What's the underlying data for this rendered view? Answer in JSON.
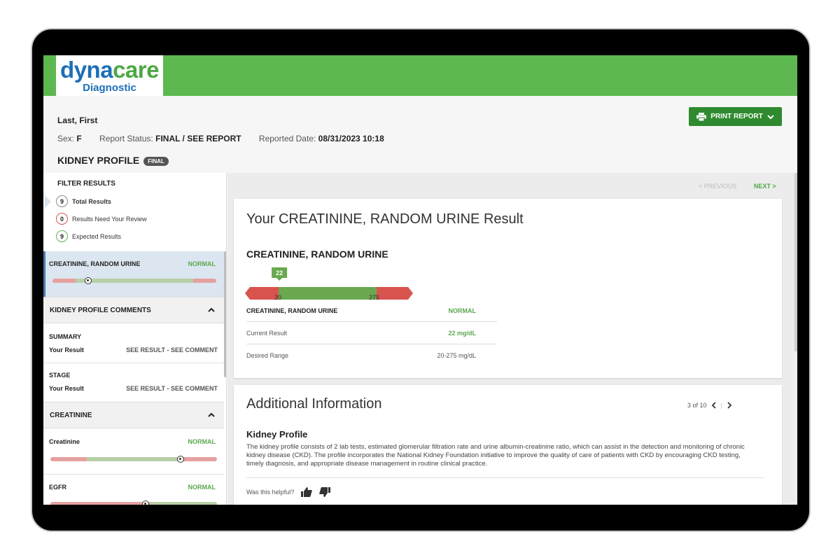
{
  "brand": {
    "name_part1": "dyna",
    "name_part2": "care",
    "subtitle": "Diagnostic",
    "green": "#5cb84f",
    "blue": "#1d6fb8"
  },
  "patient": {
    "name": "Last, First",
    "sex_label": "Sex:",
    "sex": "F",
    "status_label": "Report Status:",
    "status": "FINAL / SEE REPORT",
    "date_label": "Reported Date:",
    "date": "08/31/2023 10:18",
    "profile": "KIDNEY PROFILE",
    "profile_badge": "FINAL"
  },
  "toolbar": {
    "print_label": "PRINT REPORT",
    "print_icon": "printer-icon"
  },
  "filters": {
    "title": "FILTER RESULTS",
    "items": [
      {
        "count": "9",
        "label": "Total Results"
      },
      {
        "count": "0",
        "label": "Results Need Your Review"
      },
      {
        "count": "9",
        "label": "Expected Results"
      }
    ]
  },
  "sidebar": {
    "selected": {
      "name": "CREATININE, RANDOM URINE",
      "status": "NORMAL",
      "marker_fraction": 0.22
    },
    "comments": {
      "title": "KIDNEY PROFILE COMMENTS",
      "summary": {
        "title": "SUMMARY",
        "label": "Your Result",
        "value": "SEE RESULT - SEE COMMENT"
      },
      "stage": {
        "title": "STAGE",
        "label": "Your Result",
        "value": "SEE RESULT - SEE COMMENT"
      }
    },
    "creatinine_section": {
      "title": "CREATININE"
    },
    "creatinine": {
      "name": "Creatinine",
      "status": "NORMAL",
      "marker_fraction": 0.78
    },
    "egfr": {
      "name": "EGFR",
      "status": "NORMAL",
      "marker_fraction": 0.57
    }
  },
  "nav": {
    "previous": "< PREVIOUS",
    "next": "NEXT >"
  },
  "result_card": {
    "title": "Your CREATININE, RANDOM URINE Result",
    "test_name": "CREATININE, RANDOM URINE",
    "value": 22,
    "value_label": "22",
    "range_low_label": "20",
    "range_high_label": "275",
    "table": {
      "header_label": "CREATININE, RANDOM URINE",
      "header_status": "NORMAL",
      "current_label": "Current Result",
      "current_value": "22 mg/dL",
      "range_label": "Desired Range",
      "range_value": "20-275 mg/dL"
    }
  },
  "info_card": {
    "title": "Additional Information",
    "pager": "3 of 10",
    "heading": "Kidney Profile",
    "text": "The kidney profile consists of 2 lab tests, estimated glomerular filtration rate and urine albumin-creatinine ratio, which can assist in the detection and monitoring of chronic kidney disease (CKD). The profile incorporates the National Kidney Foundation initiative to improve the quality of care of patients with CKD by encouraging CKD testing, timely diagnosis, and appropriate disease management in routine clinical practice.",
    "helpful_label": "Was this helpful?"
  }
}
